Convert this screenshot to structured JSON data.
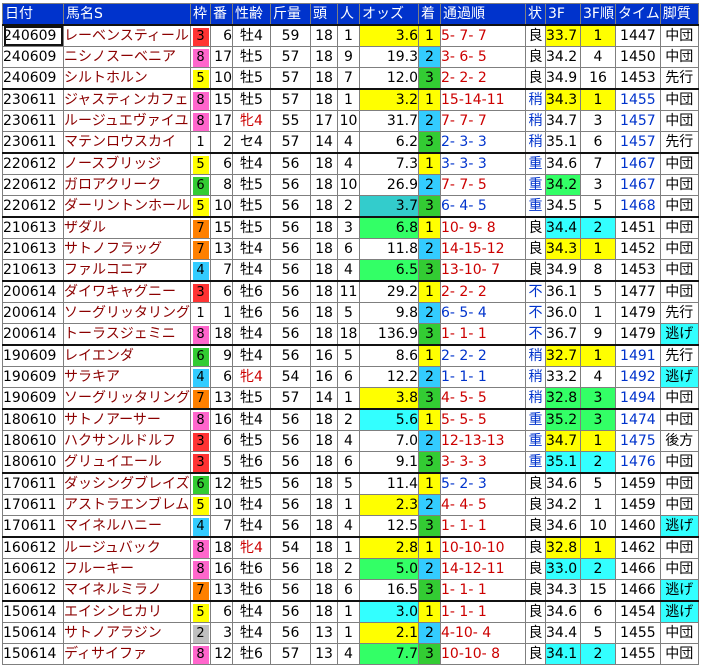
{
  "headers": [
    "日付",
    "馬名S",
    "枠",
    "番",
    "性齢",
    "斤量",
    "頭",
    "人",
    "オッズ",
    "着",
    "通過順",
    "状",
    "3F",
    "3F順",
    "タイム",
    "脚質"
  ],
  "palette": {
    "gate": {
      "1": "#ffffff",
      "2": "#bfbfbf",
      "3": "#ff3333",
      "4": "#33ccff",
      "5": "#ffff00",
      "6": "#33cc33",
      "7": "#ff8000",
      "8": "#ff66cc"
    },
    "finish": {
      "1": "#ffff00",
      "2": "#33ccff",
      "3": "#33cc33"
    },
    "highlight": {
      "yellow": "#ffff00",
      "green": "#33ff66",
      "cyan": "#33ffff",
      "teal": "#33cccc"
    }
  },
  "rows": [
    {
      "date": "240609",
      "name": "レーベンスティール",
      "gate": "3",
      "num": "6",
      "sexage": "牡4",
      "weight": "59",
      "field": "18",
      "pop": "1",
      "odds": "3.6",
      "odds_bg": "yellow",
      "fin": "1",
      "pass": "5- 7- 7",
      "pass_color": "red",
      "going": "良",
      "f3": "33.7",
      "f3_bg": "yellow",
      "f3rank": "1",
      "f3rank_bg": "yellow",
      "time": "1447",
      "time_blue": false,
      "style": "中団",
      "style_bg": "",
      "group_start": true,
      "selected": true
    },
    {
      "date": "240609",
      "name": "ニシノスーベニア",
      "gate": "8",
      "num": "17",
      "sexage": "牡5",
      "weight": "57",
      "field": "18",
      "pop": "9",
      "odds": "19.3",
      "odds_bg": "",
      "fin": "2",
      "pass": "3- 6- 5",
      "pass_color": "red",
      "going": "良",
      "f3": "34.2",
      "f3_bg": "",
      "f3rank": "4",
      "f3rank_bg": "",
      "time": "1450",
      "time_blue": false,
      "style": "中団",
      "style_bg": ""
    },
    {
      "date": "240609",
      "name": "シルトホルン",
      "gate": "5",
      "num": "10",
      "sexage": "牡5",
      "weight": "57",
      "field": "18",
      "pop": "7",
      "odds": "12.0",
      "odds_bg": "",
      "fin": "3",
      "pass": "2- 2- 2",
      "pass_color": "red",
      "going": "良",
      "f3": "34.9",
      "f3_bg": "",
      "f3rank": "16",
      "f3rank_bg": "",
      "time": "1453",
      "time_blue": false,
      "style": "先行",
      "style_bg": ""
    },
    {
      "date": "230611",
      "name": "ジャスティンカフェ",
      "gate": "8",
      "num": "15",
      "sexage": "牡5",
      "weight": "57",
      "field": "18",
      "pop": "1",
      "odds": "3.2",
      "odds_bg": "yellow",
      "fin": "1",
      "pass": "15-14-11",
      "pass_color": "red",
      "going": "稍",
      "f3": "34.3",
      "f3_bg": "yellow",
      "f3rank": "1",
      "f3rank_bg": "yellow",
      "time": "1455",
      "time_blue": true,
      "style": "中団",
      "style_bg": "",
      "group_start": true
    },
    {
      "date": "230611",
      "name": "ルージュエヴァイユ",
      "gate": "8",
      "num": "17",
      "sexage": "牝4",
      "weight": "55",
      "field": "17",
      "pop": "10",
      "odds": "31.7",
      "odds_bg": "",
      "fin": "2",
      "pass": "7- 7- 7",
      "pass_color": "red",
      "going": "稍",
      "f3": "34.7",
      "f3_bg": "",
      "f3rank": "3",
      "f3rank_bg": "",
      "time": "1457",
      "time_blue": true,
      "style": "中団",
      "style_bg": ""
    },
    {
      "date": "230611",
      "name": "マテンロウスカイ",
      "gate": "1",
      "num": "2",
      "sexage": "セ4",
      "weight": "57",
      "field": "14",
      "pop": "4",
      "odds": "6.2",
      "odds_bg": "",
      "fin": "3",
      "pass": "2- 3- 3",
      "pass_color": "blue",
      "going": "稍",
      "f3": "35.1",
      "f3_bg": "",
      "f3rank": "6",
      "f3rank_bg": "",
      "time": "1457",
      "time_blue": true,
      "style": "先行",
      "style_bg": ""
    },
    {
      "date": "220612",
      "name": "ノースブリッジ",
      "gate": "5",
      "num": "6",
      "sexage": "牡4",
      "weight": "56",
      "field": "18",
      "pop": "4",
      "odds": "7.3",
      "odds_bg": "",
      "fin": "1",
      "pass": "3- 3- 3",
      "pass_color": "blue",
      "going": "重",
      "f3": "34.6",
      "f3_bg": "",
      "f3rank": "7",
      "f3rank_bg": "",
      "time": "1467",
      "time_blue": true,
      "style": "中団",
      "style_bg": "",
      "group_start": true
    },
    {
      "date": "220612",
      "name": "ガロアクリーク",
      "gate": "6",
      "num": "8",
      "sexage": "牡5",
      "weight": "56",
      "field": "18",
      "pop": "10",
      "odds": "26.9",
      "odds_bg": "",
      "fin": "2",
      "pass": "7- 7- 5",
      "pass_color": "red",
      "going": "重",
      "f3": "34.2",
      "f3_bg": "green",
      "f3rank": "3",
      "f3rank_bg": "",
      "time": "1467",
      "time_blue": true,
      "style": "中団",
      "style_bg": ""
    },
    {
      "date": "220612",
      "name": "ダーリントンホール",
      "gate": "5",
      "num": "10",
      "sexage": "牡5",
      "weight": "56",
      "field": "18",
      "pop": "2",
      "odds": "3.7",
      "odds_bg": "teal",
      "fin": "3",
      "pass": "6- 4- 5",
      "pass_color": "blue",
      "going": "重",
      "f3": "34.5",
      "f3_bg": "",
      "f3rank": "5",
      "f3rank_bg": "",
      "time": "1468",
      "time_blue": true,
      "style": "中団",
      "style_bg": ""
    },
    {
      "date": "210613",
      "name": "ザダル",
      "gate": "7",
      "num": "15",
      "sexage": "牡5",
      "weight": "56",
      "field": "18",
      "pop": "3",
      "odds": "6.8",
      "odds_bg": "green",
      "fin": "1",
      "pass": "10- 9- 8",
      "pass_color": "red",
      "going": "良",
      "f3": "34.4",
      "f3_bg": "cyan",
      "f3rank": "2",
      "f3rank_bg": "cyan",
      "time": "1451",
      "time_blue": false,
      "style": "中団",
      "style_bg": "",
      "group_start": true
    },
    {
      "date": "210613",
      "name": "サトノフラッグ",
      "gate": "7",
      "num": "13",
      "sexage": "牡4",
      "weight": "56",
      "field": "18",
      "pop": "6",
      "odds": "11.8",
      "odds_bg": "",
      "fin": "2",
      "pass": "14-15-12",
      "pass_color": "red",
      "going": "良",
      "f3": "34.3",
      "f3_bg": "yellow",
      "f3rank": "1",
      "f3rank_bg": "yellow",
      "time": "1452",
      "time_blue": false,
      "style": "中団",
      "style_bg": ""
    },
    {
      "date": "210613",
      "name": "ファルコニア",
      "gate": "4",
      "num": "7",
      "sexage": "牡4",
      "weight": "56",
      "field": "18",
      "pop": "4",
      "odds": "6.5",
      "odds_bg": "green",
      "fin": "3",
      "pass": "13-10- 7",
      "pass_color": "red",
      "going": "良",
      "f3": "34.9",
      "f3_bg": "",
      "f3rank": "8",
      "f3rank_bg": "",
      "time": "1453",
      "time_blue": false,
      "style": "中団",
      "style_bg": ""
    },
    {
      "date": "200614",
      "name": "ダイワキャグニー",
      "gate": "3",
      "num": "6",
      "sexage": "牡6",
      "weight": "56",
      "field": "18",
      "pop": "11",
      "odds": "29.2",
      "odds_bg": "",
      "fin": "1",
      "pass": "2- 2- 2",
      "pass_color": "red",
      "going": "不",
      "f3": "36.1",
      "f3_bg": "",
      "f3rank": "5",
      "f3rank_bg": "",
      "time": "1477",
      "time_blue": false,
      "style": "中団",
      "style_bg": "",
      "group_start": true
    },
    {
      "date": "200614",
      "name": "ソーグリッタリング",
      "gate": "1",
      "num": "1",
      "sexage": "牡6",
      "weight": "56",
      "field": "18",
      "pop": "5",
      "odds": "9.8",
      "odds_bg": "",
      "fin": "2",
      "pass": "6- 5- 4",
      "pass_color": "blue",
      "going": "不",
      "f3": "36.0",
      "f3_bg": "",
      "f3rank": "1",
      "f3rank_bg": "",
      "time": "1479",
      "time_blue": false,
      "style": "先行",
      "style_bg": ""
    },
    {
      "date": "200614",
      "name": "トーラスジェミニ",
      "gate": "8",
      "num": "18",
      "sexage": "牡4",
      "weight": "56",
      "field": "18",
      "pop": "18",
      "odds": "136.9",
      "odds_bg": "",
      "fin": "3",
      "pass": "1- 1- 1",
      "pass_color": "red",
      "going": "不",
      "f3": "36.7",
      "f3_bg": "",
      "f3rank": "9",
      "f3rank_bg": "",
      "time": "1479",
      "time_blue": false,
      "style": "逃げ",
      "style_bg": "cyan"
    },
    {
      "date": "190609",
      "name": "レイエンダ",
      "gate": "6",
      "num": "9",
      "sexage": "牡4",
      "weight": "56",
      "field": "16",
      "pop": "5",
      "odds": "8.6",
      "odds_bg": "",
      "fin": "1",
      "pass": "2- 2- 2",
      "pass_color": "blue",
      "going": "稍",
      "f3": "32.7",
      "f3_bg": "yellow",
      "f3rank": "1",
      "f3rank_bg": "yellow",
      "time": "1491",
      "time_blue": true,
      "style": "先行",
      "style_bg": "",
      "group_start": true
    },
    {
      "date": "190609",
      "name": "サラキア",
      "gate": "4",
      "num": "6",
      "sexage": "牝4",
      "weight": "54",
      "field": "16",
      "pop": "6",
      "odds": "12.2",
      "odds_bg": "",
      "fin": "2",
      "pass": "1- 1- 1",
      "pass_color": "blue",
      "going": "稍",
      "f3": "33.2",
      "f3_bg": "",
      "f3rank": "4",
      "f3rank_bg": "",
      "time": "1492",
      "time_blue": true,
      "style": "逃げ",
      "style_bg": "cyan"
    },
    {
      "date": "190609",
      "name": "ソーグリッタリング",
      "gate": "7",
      "num": "13",
      "sexage": "牡5",
      "weight": "57",
      "field": "14",
      "pop": "1",
      "odds": "3.8",
      "odds_bg": "yellow",
      "fin": "3",
      "pass": "4- 5- 5",
      "pass_color": "red",
      "going": "稍",
      "f3": "32.8",
      "f3_bg": "green",
      "f3rank": "3",
      "f3rank_bg": "green",
      "time": "1494",
      "time_blue": true,
      "style": "中団",
      "style_bg": ""
    },
    {
      "date": "180610",
      "name": "サトノアーサー",
      "gate": "8",
      "num": "16",
      "sexage": "牡4",
      "weight": "56",
      "field": "18",
      "pop": "2",
      "odds": "5.6",
      "odds_bg": "cyan",
      "fin": "1",
      "pass": "5- 5- 5",
      "pass_color": "red",
      "going": "重",
      "f3": "35.2",
      "f3_bg": "green",
      "f3rank": "3",
      "f3rank_bg": "green",
      "time": "1474",
      "time_blue": true,
      "style": "中団",
      "style_bg": "",
      "group_start": true
    },
    {
      "date": "180610",
      "name": "ハクサンルドルフ",
      "gate": "3",
      "num": "6",
      "sexage": "牡5",
      "weight": "56",
      "field": "18",
      "pop": "4",
      "odds": "7.0",
      "odds_bg": "",
      "fin": "2",
      "pass": "12-13-13",
      "pass_color": "red",
      "going": "重",
      "f3": "34.7",
      "f3_bg": "yellow",
      "f3rank": "1",
      "f3rank_bg": "yellow",
      "time": "1475",
      "time_blue": true,
      "style": "後方",
      "style_bg": ""
    },
    {
      "date": "180610",
      "name": "グリュイエール",
      "gate": "3",
      "num": "5",
      "sexage": "牡6",
      "weight": "56",
      "field": "18",
      "pop": "6",
      "odds": "9.1",
      "odds_bg": "",
      "fin": "3",
      "pass": "3- 3- 3",
      "pass_color": "red",
      "going": "重",
      "f3": "35.1",
      "f3_bg": "cyan",
      "f3rank": "2",
      "f3rank_bg": "cyan",
      "time": "1476",
      "time_blue": true,
      "style": "中団",
      "style_bg": ""
    },
    {
      "date": "170611",
      "name": "ダッシングブレイズ",
      "gate": "6",
      "num": "12",
      "sexage": "牡5",
      "weight": "56",
      "field": "18",
      "pop": "5",
      "odds": "11.4",
      "odds_bg": "",
      "fin": "1",
      "pass": "5- 2- 3",
      "pass_color": "blue",
      "going": "良",
      "f3": "34.6",
      "f3_bg": "",
      "f3rank": "5",
      "f3rank_bg": "",
      "time": "1459",
      "time_blue": false,
      "style": "中団",
      "style_bg": "",
      "group_start": true
    },
    {
      "date": "170611",
      "name": "アストラエンブレム",
      "gate": "5",
      "num": "10",
      "sexage": "牡4",
      "weight": "56",
      "field": "18",
      "pop": "1",
      "odds": "2.3",
      "odds_bg": "yellow",
      "fin": "2",
      "pass": "4- 4- 5",
      "pass_color": "red",
      "going": "良",
      "f3": "34.2",
      "f3_bg": "",
      "f3rank": "1",
      "f3rank_bg": "",
      "time": "1459",
      "time_blue": false,
      "style": "中団",
      "style_bg": ""
    },
    {
      "date": "170611",
      "name": "マイネルハニー",
      "gate": "4",
      "num": "7",
      "sexage": "牡4",
      "weight": "56",
      "field": "18",
      "pop": "4",
      "odds": "12.5",
      "odds_bg": "",
      "fin": "3",
      "pass": "1- 1- 1",
      "pass_color": "red",
      "going": "良",
      "f3": "34.6",
      "f3_bg": "",
      "f3rank": "10",
      "f3rank_bg": "",
      "time": "1460",
      "time_blue": false,
      "style": "逃げ",
      "style_bg": "cyan"
    },
    {
      "date": "160612",
      "name": "ルージュバック",
      "gate": "8",
      "num": "18",
      "sexage": "牝4",
      "weight": "54",
      "field": "18",
      "pop": "1",
      "odds": "2.8",
      "odds_bg": "yellow",
      "fin": "1",
      "pass": "10-10-10",
      "pass_color": "red",
      "going": "良",
      "f3": "32.8",
      "f3_bg": "yellow",
      "f3rank": "1",
      "f3rank_bg": "yellow",
      "time": "1462",
      "time_blue": false,
      "style": "中団",
      "style_bg": "",
      "group_start": true
    },
    {
      "date": "160612",
      "name": "フルーキー",
      "gate": "8",
      "num": "16",
      "sexage": "牡6",
      "weight": "56",
      "field": "18",
      "pop": "2",
      "odds": "5.0",
      "odds_bg": "green",
      "fin": "2",
      "pass": "14-12-11",
      "pass_color": "red",
      "going": "良",
      "f3": "33.0",
      "f3_bg": "cyan",
      "f3rank": "2",
      "f3rank_bg": "cyan",
      "time": "1466",
      "time_blue": false,
      "style": "中団",
      "style_bg": ""
    },
    {
      "date": "160612",
      "name": "マイネルミラノ",
      "gate": "7",
      "num": "13",
      "sexage": "牡6",
      "weight": "56",
      "field": "18",
      "pop": "6",
      "odds": "16.5",
      "odds_bg": "",
      "fin": "3",
      "pass": "1- 1- 1",
      "pass_color": "red",
      "going": "良",
      "f3": "34.3",
      "f3_bg": "",
      "f3rank": "15",
      "f3rank_bg": "",
      "time": "1466",
      "time_blue": false,
      "style": "逃げ",
      "style_bg": "cyan"
    },
    {
      "date": "150614",
      "name": "エイシンヒカリ",
      "gate": "5",
      "num": "6",
      "sexage": "牡4",
      "weight": "56",
      "field": "18",
      "pop": "1",
      "odds": "3.0",
      "odds_bg": "cyan",
      "fin": "1",
      "pass": "1- 1- 1",
      "pass_color": "red",
      "going": "良",
      "f3": "34.6",
      "f3_bg": "",
      "f3rank": "6",
      "f3rank_bg": "",
      "time": "1454",
      "time_blue": false,
      "style": "逃げ",
      "style_bg": "cyan",
      "group_start": true
    },
    {
      "date": "150614",
      "name": "サトノアラジン",
      "gate": "2",
      "num": "3",
      "sexage": "牡4",
      "weight": "56",
      "field": "13",
      "pop": "1",
      "odds": "2.1",
      "odds_bg": "yellow",
      "fin": "2",
      "pass": "4-10- 4",
      "pass_color": "red",
      "going": "良",
      "f3": "34.4",
      "f3_bg": "",
      "f3rank": "5",
      "f3rank_bg": "",
      "time": "1455",
      "time_blue": false,
      "style": "中団",
      "style_bg": ""
    },
    {
      "date": "150614",
      "name": "ディサイファ",
      "gate": "8",
      "num": "12",
      "sexage": "牡6",
      "weight": "57",
      "field": "13",
      "pop": "4",
      "odds": "7.7",
      "odds_bg": "green",
      "fin": "3",
      "pass": "10-10- 8",
      "pass_color": "red",
      "going": "良",
      "f3": "34.1",
      "f3_bg": "cyan",
      "f3rank": "2",
      "f3rank_bg": "cyan",
      "time": "1455",
      "time_blue": false,
      "style": "中団",
      "style_bg": ""
    }
  ]
}
